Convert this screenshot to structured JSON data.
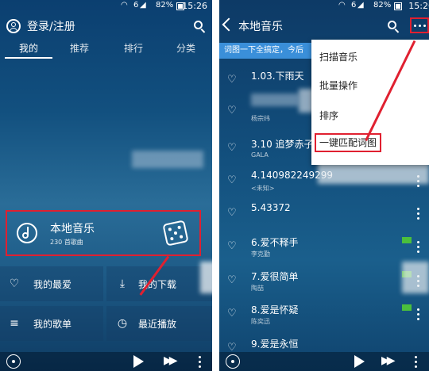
{
  "status_bar": {
    "battery": "82%",
    "time": "15:26",
    "network": "6"
  },
  "left_screen": {
    "header": {
      "title": "登录/注册"
    },
    "tabs": [
      "我的",
      "推荐",
      "排行",
      "分类"
    ],
    "local_music": {
      "title": "本地音乐",
      "count": "230 首歌曲"
    },
    "grid": {
      "favorites": "我的最爱",
      "downloads": "我的下载",
      "playlists": "我的歌单",
      "recent": "最近播放"
    }
  },
  "right_screen": {
    "header": {
      "title": "本地音乐"
    },
    "banner": "词图一下全搞定，今后",
    "menu": [
      "扫描音乐",
      "批量操作",
      "排序",
      "一键匹配词图"
    ],
    "songs": [
      {
        "title": "1.03.下雨天",
        "artist": "",
        "hq": false
      },
      {
        "title": "",
        "artist": "杨宗纬",
        "hq": false
      },
      {
        "title": "3.10 追梦赤子",
        "artist": "GALA",
        "hq": false
      },
      {
        "title": "4.140982249299",
        "artist": "<未知>",
        "hq": false
      },
      {
        "title": "5.43372",
        "artist": "",
        "hq": false
      },
      {
        "title": "6.爱不释手",
        "artist": "李克勤",
        "hq": true
      },
      {
        "title": "7.爱很简单",
        "artist": "陶喆",
        "hq": true
      },
      {
        "title": "8.爱是怀疑",
        "artist": "陈奕迅",
        "hq": true
      },
      {
        "title": "9.爱是永恒",
        "artist": "",
        "hq": false
      }
    ]
  },
  "colors": {
    "highlight": "#e02030",
    "banner": "#3a8fd9",
    "hq_badge": "#4bbf3c"
  }
}
